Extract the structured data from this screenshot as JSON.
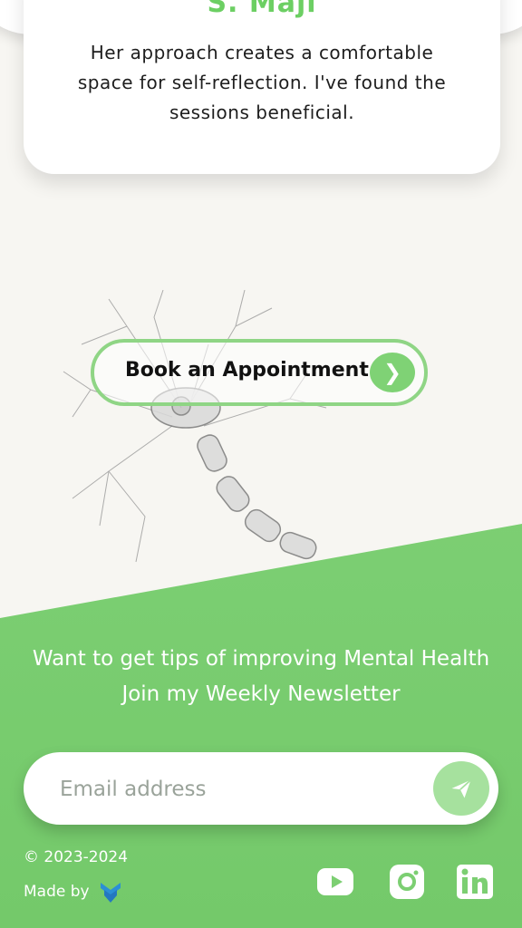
{
  "testimonial": {
    "name": "S. Maji",
    "text": "Her approach creates a comfortable space for self-reflection. I've found the sessions beneficial.",
    "prev_icon": "chevron-left-icon",
    "next_icon": "chevron-right-icon"
  },
  "cta": {
    "book_label": "Book an Appointment",
    "arrow_icon": "chevron-right-icon"
  },
  "newsletter": {
    "line1": "Want to get tips of improving Mental Health",
    "line2": "Join my Weekly Newsletter",
    "email_placeholder": "Email address",
    "send_icon": "paper-plane-icon"
  },
  "footer": {
    "copyright": "© 2023-2024",
    "made_by": "Made by",
    "social": [
      "youtube-icon",
      "instagram-icon",
      "linkedin-icon"
    ]
  },
  "colors": {
    "accent_green": "#6ccf63",
    "footer_green": "#7ccf72",
    "send_button": "#a6e19e",
    "page_bg": "#f7f6f2"
  }
}
